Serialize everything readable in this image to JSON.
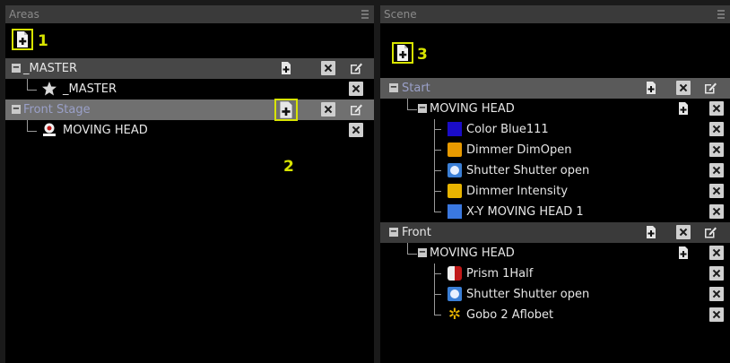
{
  "areas": {
    "title": "Areas",
    "callout": "1",
    "icons": {
      "add": "add-page-icon",
      "delete": "delete-x-icon",
      "edit": "edit-icon",
      "star": "star-icon",
      "fixture": "moving-head-icon"
    },
    "items": [
      {
        "label": "_MASTER"
      },
      {
        "label": "_MASTER"
      },
      {
        "label": "Front Stage",
        "callout": "2"
      },
      {
        "label": "MOVING HEAD"
      }
    ]
  },
  "scene": {
    "title": "Scene",
    "callout": "3",
    "icons": {
      "add": "add-page-icon",
      "delete": "delete-x-icon",
      "edit": "edit-icon"
    },
    "groups": [
      {
        "label": "Start",
        "fixture": "MOVING HEAD",
        "presets": [
          {
            "label": "Color Blue111",
            "icon": "color-swatch-icon",
            "color": "#1a0cc8"
          },
          {
            "label": "Dimmer DimOpen",
            "icon": "dimmer-icon",
            "color": "#e89a00"
          },
          {
            "label": "Shutter Shutter open",
            "icon": "shutter-icon",
            "color": "#3b7fd6"
          },
          {
            "label": "Dimmer Intensity",
            "icon": "intensity-icon",
            "color": "#e8b400"
          },
          {
            "label": "X-Y MOVING HEAD  1",
            "icon": "position-icon",
            "color": "#3a78e0"
          }
        ]
      },
      {
        "label": "Front",
        "fixture": "MOVING HEAD",
        "presets": [
          {
            "label": "Prism 1Half",
            "icon": "prism-icon",
            "color": "#c01818"
          },
          {
            "label": "Shutter Shutter open",
            "icon": "shutter-icon",
            "color": "#3b7fd6"
          },
          {
            "label": "Gobo 2 Aflobet",
            "icon": "gobo-icon",
            "color": "#e8b400"
          }
        ]
      }
    ]
  }
}
